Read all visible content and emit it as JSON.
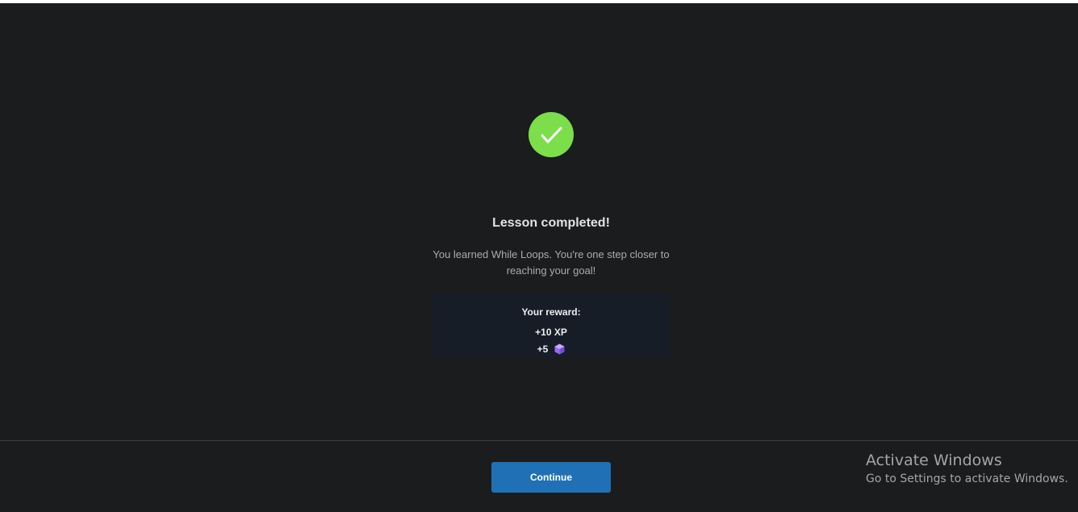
{
  "lesson": {
    "title": "Lesson completed!",
    "message": "You learned While Loops. You're one step closer to reaching your goal!"
  },
  "reward": {
    "heading": "Your reward:",
    "xp": "+10 XP",
    "gems": "+5",
    "gem_icon": "purple-gem-icon"
  },
  "footer": {
    "continue_label": "Continue"
  },
  "watermark": {
    "title": "Activate Windows",
    "subtitle": "Go to Settings to activate Windows."
  },
  "colors": {
    "background": "#1b1c1e",
    "success": "#7bde4a",
    "primary": "#1f70b5",
    "reward_box": "#171d26",
    "gem": "#9b6cf0"
  }
}
